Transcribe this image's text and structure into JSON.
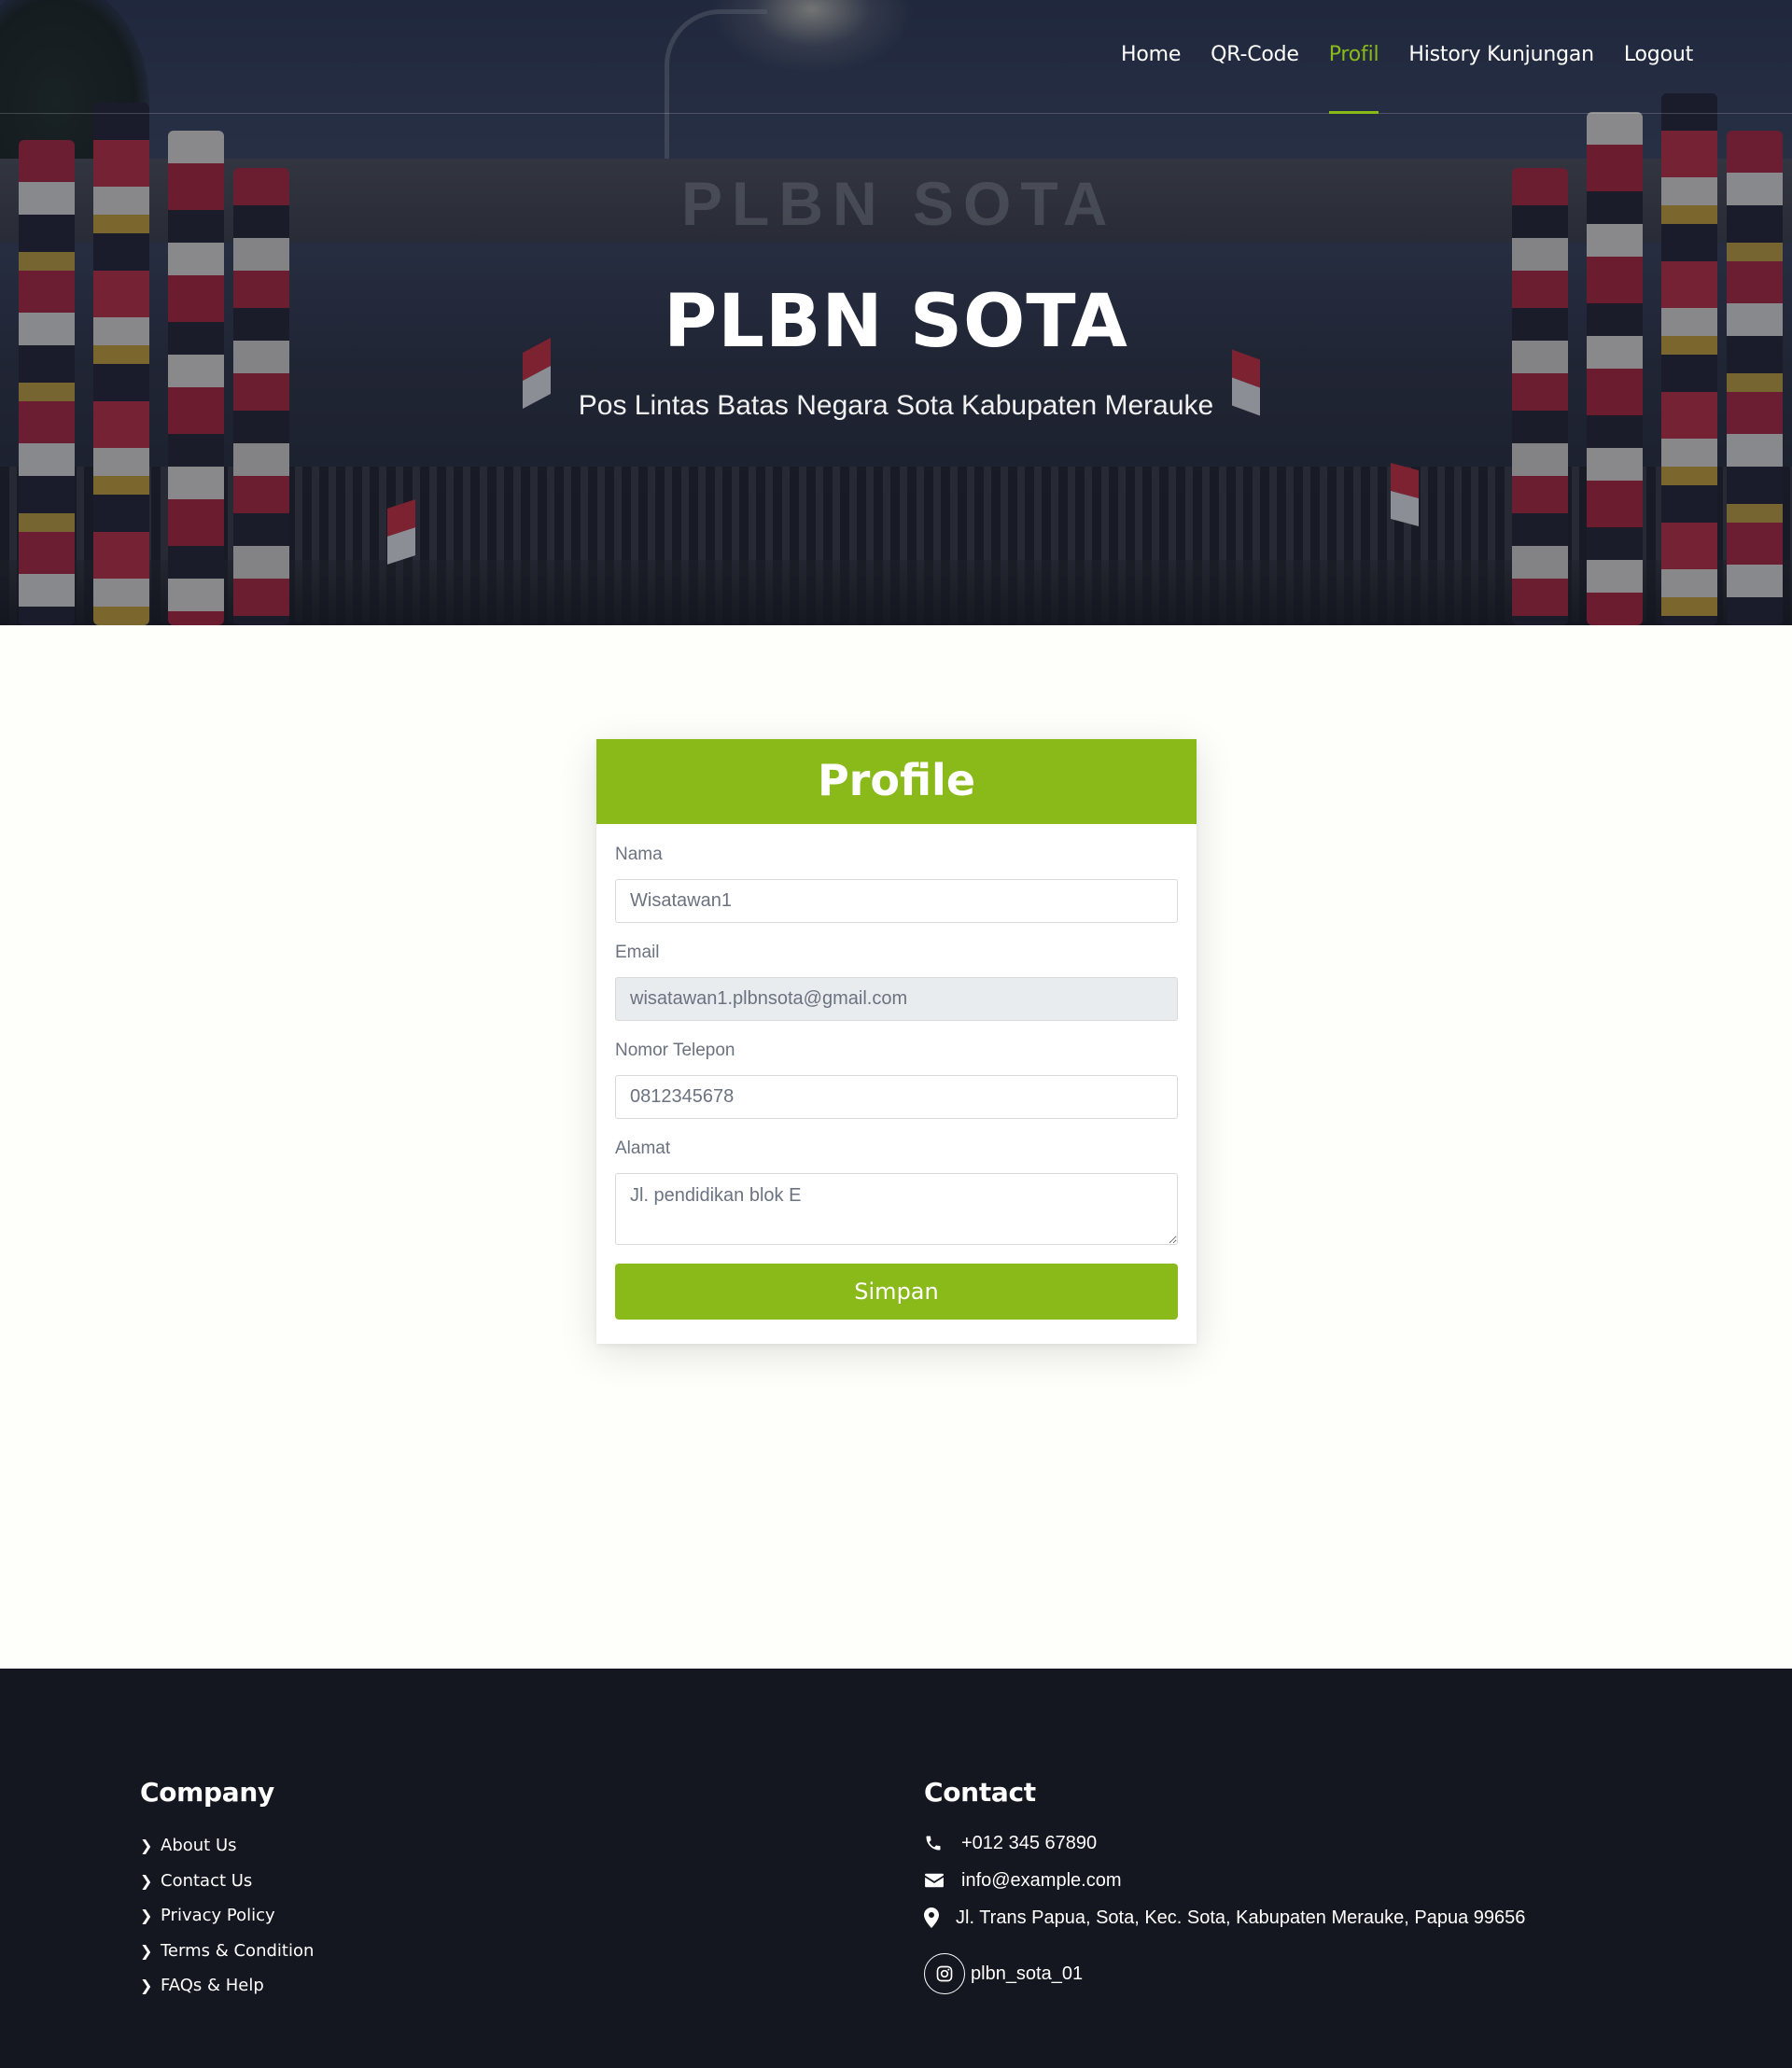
{
  "nav": {
    "items": [
      {
        "label": "Home"
      },
      {
        "label": "QR-Code"
      },
      {
        "label": "Profil",
        "active": true
      },
      {
        "label": "History Kunjungan"
      },
      {
        "label": "Logout"
      }
    ]
  },
  "hero": {
    "title": "PLBN SOTA",
    "subtitle": "Pos Lintas Batas Negara Sota Kabupaten Merauke",
    "sign_text": "PLBN SOTA"
  },
  "profile": {
    "title": "Profile",
    "fields": {
      "nama": {
        "label": "Nama",
        "value": "Wisatawan1"
      },
      "email": {
        "label": "Email",
        "value": "wisatawan1.plbnsota@gmail.com",
        "readonly": true
      },
      "telepon": {
        "label": "Nomor Telepon",
        "value": "0812345678"
      },
      "alamat": {
        "label": "Alamat",
        "value": "Jl. pendidikan blok E"
      }
    },
    "save_label": "Simpan"
  },
  "footer": {
    "company": {
      "heading": "Company",
      "links": [
        {
          "label": "About Us"
        },
        {
          "label": "Contact Us"
        },
        {
          "label": "Privacy Policy"
        },
        {
          "label": "Terms & Condition"
        },
        {
          "label": "FAQs & Help"
        }
      ]
    },
    "contact": {
      "heading": "Contact",
      "phone": "+012 345 67890",
      "email": "info@example.com",
      "address": "Jl. Trans Papua, Sota, Kec. Sota, Kabupaten Merauke, Papua 99656",
      "instagram": "plbn_sota_01"
    }
  },
  "colors": {
    "accent": "#8ab91a",
    "footer_bg": "#141620",
    "page_bg": "#fefefa"
  },
  "icons": [
    "chevron-right-icon",
    "phone-icon",
    "envelope-icon",
    "map-marker-icon",
    "instagram-icon"
  ]
}
